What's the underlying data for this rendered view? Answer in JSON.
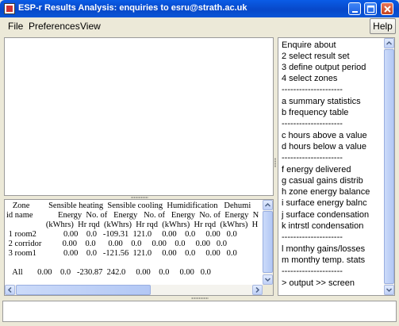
{
  "window": {
    "title": "ESP-r Results Analysis: enquiries to esru@strath.ac.uk",
    "minimize_icon": "minimize-icon",
    "maximize_icon": "maximize-icon",
    "close_icon": "close-icon"
  },
  "menubar": {
    "items": [
      "File",
      "Preferences",
      "View"
    ],
    "help_label": "Help"
  },
  "table": {
    "lines": [
      "   Zone         Sensible heating  Sensible cooling  Humidification   Dehumi",
      "id name            Energy  No. of   Energy   No. of   Energy  No. of  Energy  N",
      "                   (kWhrs)  Hr rqd  (kWhrs)  Hr rqd  (kWhrs)  Hr rqd  (kWhrs)  H",
      " 1 room2             0.00    0.0   -109.31  121.0     0.00    0.0     0.00   0.0",
      " 2 corridor          0.00    0.0      0.00    0.0     0.00    0.0     0.00   0.0",
      " 3 room1             0.00    0.0   -121.56  121.0     0.00    0.0     0.00   0.0",
      "",
      "   All       0.00    0.0   -230.87  242.0     0.00    0.0     0.00   0.0"
    ]
  },
  "panel": {
    "items": [
      "Enquire about",
      "2 select result set",
      "3 define output period",
      "4 select zones",
      "  ---------------------",
      "a summary statistics",
      "b frequency table",
      "  ---------------------",
      "c hours above a value",
      "d hours below a value",
      "  ---------------------",
      "f energy delivered",
      "g casual gains distrib",
      "h zone energy balance",
      "i surface energy balnc",
      "j surface condensation",
      "k intrstl condensation",
      "  ---------------------",
      "l monthy gains/losses",
      "m monthy temp. stats",
      "  ---------------------",
      "> output >> screen"
    ]
  },
  "colors": {
    "titlebar": "#0748c9",
    "window_bg": "#ece9d8",
    "scroll_accent": "#bfd0f7"
  }
}
